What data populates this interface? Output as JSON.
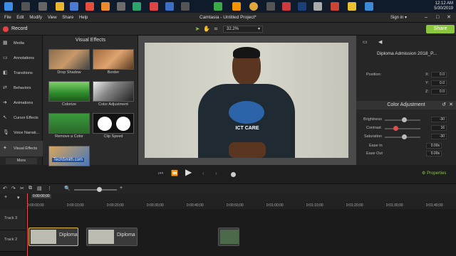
{
  "menu": {
    "file": "File",
    "edit": "Edit",
    "modify": "Modify",
    "view": "View",
    "share": "Share",
    "help": "Help"
  },
  "window": {
    "title": "Camtasia - Untitled Project*",
    "signin": "Sign in ▾"
  },
  "tray": {
    "time": "12:12 AM",
    "date": "5/30/2019"
  },
  "toolbar": {
    "record_label": "Record",
    "zoom": "32.2%",
    "share_label": "Share"
  },
  "sidebar": {
    "items": [
      {
        "label": "Media",
        "icon": "film-icon"
      },
      {
        "label": "Annotations",
        "icon": "annotation-icon"
      },
      {
        "label": "Transitions",
        "icon": "transition-icon"
      },
      {
        "label": "Behaviors",
        "icon": "behavior-icon"
      },
      {
        "label": "Animations",
        "icon": "animation-icon"
      },
      {
        "label": "Cursor Effects",
        "icon": "cursor-icon"
      },
      {
        "label": "Voice Narrati...",
        "icon": "microphone-icon"
      },
      {
        "label": "Visual Effects",
        "icon": "effects-icon"
      }
    ],
    "more": "More"
  },
  "effects": {
    "title": "Visual Effects",
    "items": [
      {
        "name": "Drop Shadow"
      },
      {
        "name": "Border"
      },
      {
        "name": "Colorize"
      },
      {
        "name": "Color Adjustment"
      },
      {
        "name": "Remove a Color"
      },
      {
        "name": "Clip Speed"
      },
      {
        "name": "TechSmith.com"
      }
    ]
  },
  "shirt": {
    "text": "ICT CARE"
  },
  "properties": {
    "clip_name": "Diploma Admission 2018_P...",
    "position_label": "Position:",
    "x_label": "X:",
    "x_value": "0.0",
    "y_label": "Y:",
    "y_value": "0.0",
    "z_label": "Z:",
    "z_value": "0.0",
    "ca_title": "Color Adjustment",
    "brightness_label": "Brightness",
    "brightness_value": "-30",
    "contrast_label": "Contrast",
    "contrast_value": "16",
    "saturation_label": "Saturation",
    "saturation_value": "-30",
    "brightness_level": 0.55,
    "contrast_level": 0.3,
    "saturation_level": 0.55,
    "ease_in_label": "Ease In",
    "ease_in_value": "0.00s",
    "ease_out_label": "Ease Out",
    "ease_out_value": "0.00s",
    "properties_button": "Properties"
  },
  "timeline": {
    "playhead": "0:00:00;00",
    "ticks": [
      "0:00:00;00",
      "0:00:10;00",
      "0:00:20;00",
      "0:00:30;00",
      "0:00:40;00",
      "0:00:50;00",
      "0:01:00;00",
      "0:01:10;00",
      "0:01:20;00",
      "0:01:30;00",
      "0:01:40;00"
    ],
    "track3": "Track 3",
    "track2": "Track 2",
    "clip1": "Diploma",
    "clip2": "Diploma"
  },
  "colors": {
    "accent": "#8cc63f",
    "record": "#e64141",
    "playhead": "#e04e4e"
  }
}
